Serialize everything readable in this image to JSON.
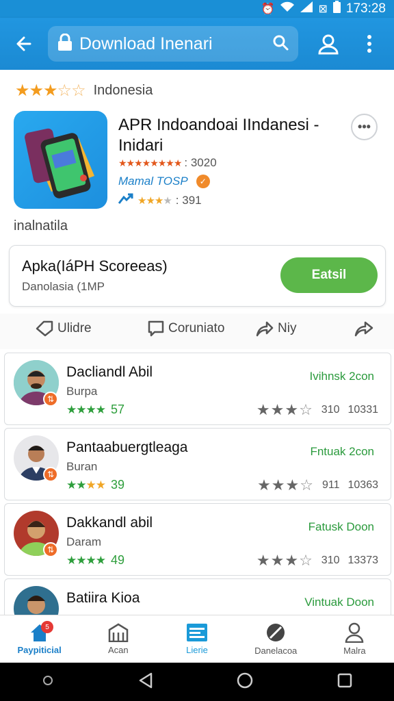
{
  "status_bar": {
    "time": "173:28"
  },
  "app_bar": {
    "search_text": "Download Inenari"
  },
  "top_rating": {
    "country": "Indonesia"
  },
  "app": {
    "title": "APR Indoandoai IIndanesi - Inidari",
    "rating_count": ": 3020",
    "developer": "Mamal TOSP",
    "downloads": ": 391",
    "country_label": "inalnatila"
  },
  "install": {
    "title": "Apka(IáPH Scoreeas)",
    "subtitle": "Danolasia (1MP",
    "button_label": "Eatsil"
  },
  "actions": {
    "share": "Ulidre",
    "comment": "Coruniato",
    "forward": "Niy"
  },
  "reviews": [
    {
      "name": "Dacliandl Abil",
      "sub": "Burpa",
      "score": "57",
      "tag": "Ivihnsk 2con",
      "n1": "310",
      "n2": "10331"
    },
    {
      "name": "Pantaabuergtleaga",
      "sub": "Buran",
      "score": "39",
      "tag": "Fntuak 2con",
      "n1": "911",
      "n2": "10363"
    },
    {
      "name": "Dakkandl abil",
      "sub": "Daram",
      "score": "49",
      "tag": "Fatusk Doon",
      "n1": "310",
      "n2": "13373"
    },
    {
      "name": "Batiira Kioa",
      "sub": "",
      "score": "",
      "tag": "Vintuak Doon",
      "n1": "",
      "n2": ""
    }
  ],
  "bottom_nav": [
    {
      "label": "Paypiticial",
      "icon": "home-icon",
      "badge": "5"
    },
    {
      "label": "Acan",
      "icon": "building-icon"
    },
    {
      "label": "Lierie",
      "icon": "list-icon"
    },
    {
      "label": "Danelacoa",
      "icon": "compass-icon"
    },
    {
      "label": "Malra",
      "icon": "person-icon"
    }
  ],
  "colors": {
    "primary": "#1b8ad3",
    "install": "#5cb74a",
    "star": "#f39c1f",
    "review_green": "#2a9a3c"
  }
}
